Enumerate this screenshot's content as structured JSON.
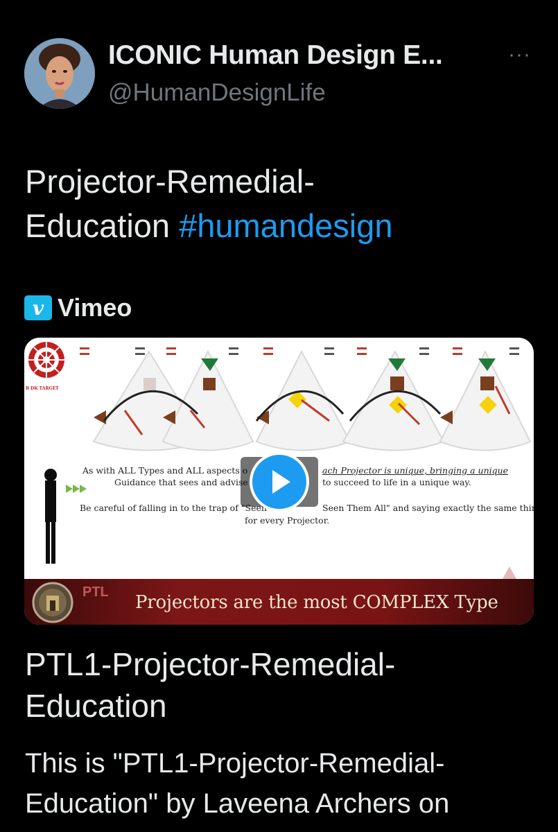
{
  "author": {
    "display_name": "ICONIC Human Design E...",
    "handle": "@HumanDesignLife"
  },
  "header": {
    "more_label": "···"
  },
  "tweet": {
    "text_line1": "Projector-Remedial-",
    "text_line2_plain": "Education ",
    "hashtag": "#humandesign"
  },
  "card": {
    "source_badge": "v",
    "source_name": "Vimeo",
    "thumbnail": {
      "line1a": "As with ALL Types and ALL aspects o",
      "line1b": "ach Projector is unique, bringing a unique",
      "line2a": "Guidance that sees and advise",
      "line2b": "to succeed to life in a unique way.",
      "line3a": "Be careful of falling in to the trap of \"Seen O",
      "line3b": "Seen Them All\" and saying exactly the same thing",
      "line4": "for every Projector.",
      "logo_caption": "B DK TARGET",
      "banner_label": "PTL",
      "banner_text": "Projectors are the most COMPLEX Type"
    },
    "title_line1": "PTL1-Projector-Remedial-",
    "title_line2": "Education",
    "desc_line1": "This is \"PTL1-Projector-Remedial-",
    "desc_line2": "Education\" by Laveena Archers on"
  },
  "colors": {
    "background": "#000000",
    "text": "#e7e9ea",
    "secondary": "#71767b",
    "link": "#1d9bf0",
    "vimeo": "#1ab7ea",
    "banner": "#7d1616"
  },
  "icons": {
    "more": "more-dots-icon",
    "vimeo": "vimeo-logo-icon",
    "play": "play-icon"
  }
}
